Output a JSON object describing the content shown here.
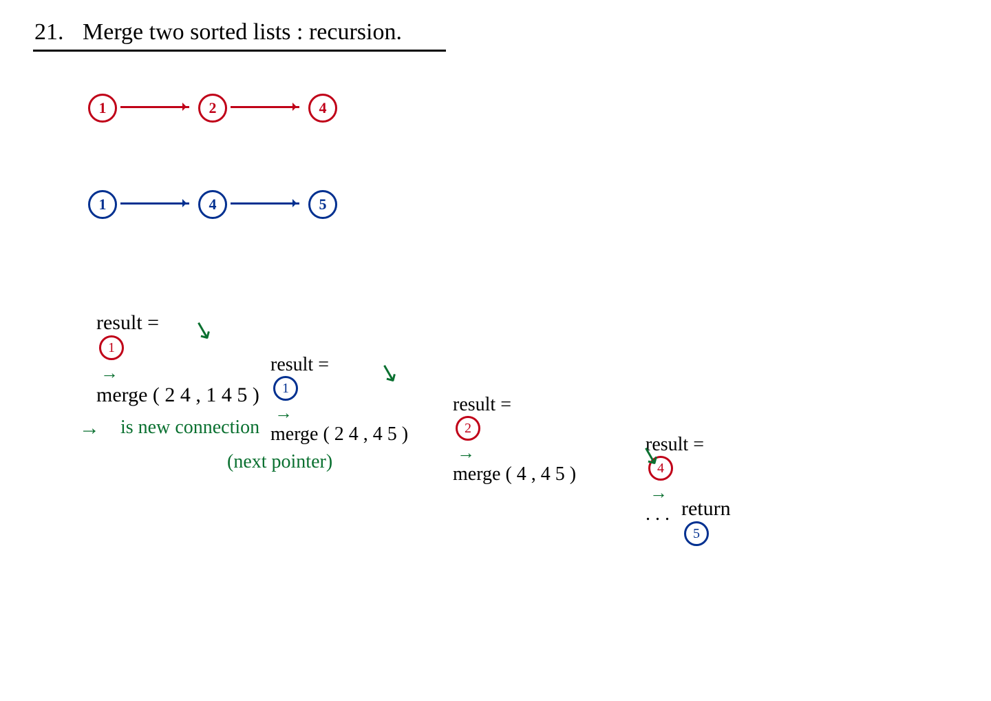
{
  "title_num": "21.",
  "title_text": "Merge two sorted lists : recursion.",
  "list1": {
    "n1": "1",
    "n2": "2",
    "n3": "4"
  },
  "list2": {
    "n1": "1",
    "n2": "4",
    "n3": "5"
  },
  "step1": {
    "label": "result =",
    "node": "1",
    "call": "merge ( 2 4 , 1 4 5 )"
  },
  "step2": {
    "label": "result =",
    "node": "1",
    "call": "merge ( 2 4 , 4 5 )"
  },
  "step3": {
    "label": "result =",
    "node": "2",
    "call": "merge ( 4 , 4 5 )"
  },
  "step4": {
    "label": "result =",
    "node": "4",
    "call": ". . ."
  },
  "step5": {
    "label": "return",
    "node": "5"
  },
  "legend_arrow": "→",
  "legend_text1": "is new connection",
  "legend_text2": "(next pointer)"
}
